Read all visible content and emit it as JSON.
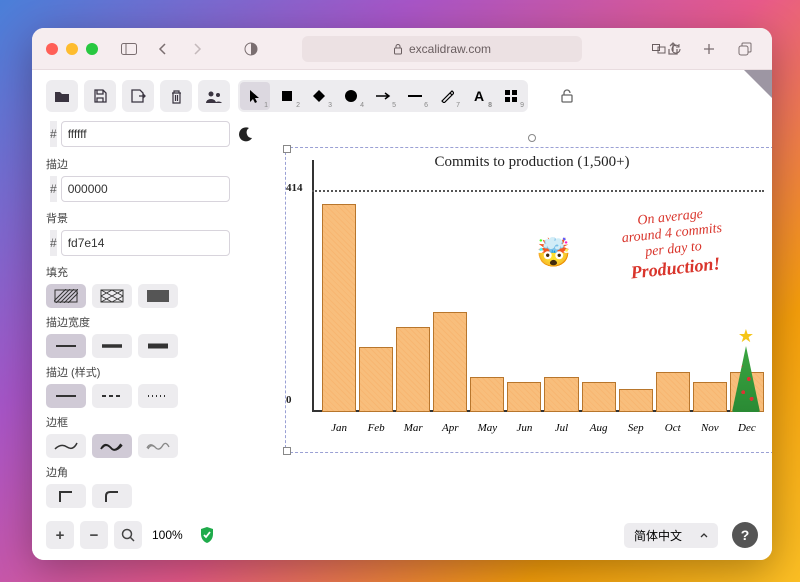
{
  "browser": {
    "url": "excalidraw.com"
  },
  "colors": {
    "canvas_hex": "ffffff",
    "stroke_hex": "000000",
    "bg_hex": "fd7e14",
    "stroke_swatch": "#000000",
    "bg_swatch": "#fd7e14"
  },
  "panel": {
    "stroke_label": "描边",
    "background_label": "背景",
    "fill_label": "填充",
    "stroke_width_label": "描边宽度",
    "stroke_style_label": "描边 (样式)",
    "sloppiness_label": "边框",
    "edges_label": "边角"
  },
  "footer": {
    "zoom": "100%",
    "language": "简体中文"
  },
  "chart": {
    "title": "Commits to production (1,500+)",
    "ymax_label": "414",
    "ymin_label": "0",
    "annotation_lines": [
      "On average",
      "around 4 commits",
      "per day to"
    ],
    "annotation_big": "Production!"
  },
  "chart_data": {
    "type": "bar",
    "title": "Commits to production (1,500+)",
    "xlabel": "",
    "ylabel": "",
    "ylim": [
      0,
      414
    ],
    "categories": [
      "Jan",
      "Feb",
      "Mar",
      "Apr",
      "May",
      "Jun",
      "Jul",
      "Aug",
      "Sep",
      "Oct",
      "Nov",
      "Dec"
    ],
    "values": [
      414,
      130,
      170,
      200,
      70,
      60,
      70,
      60,
      45,
      80,
      60,
      80
    ],
    "annotations": [
      "On average around 4 commits per day to Production!"
    ]
  }
}
